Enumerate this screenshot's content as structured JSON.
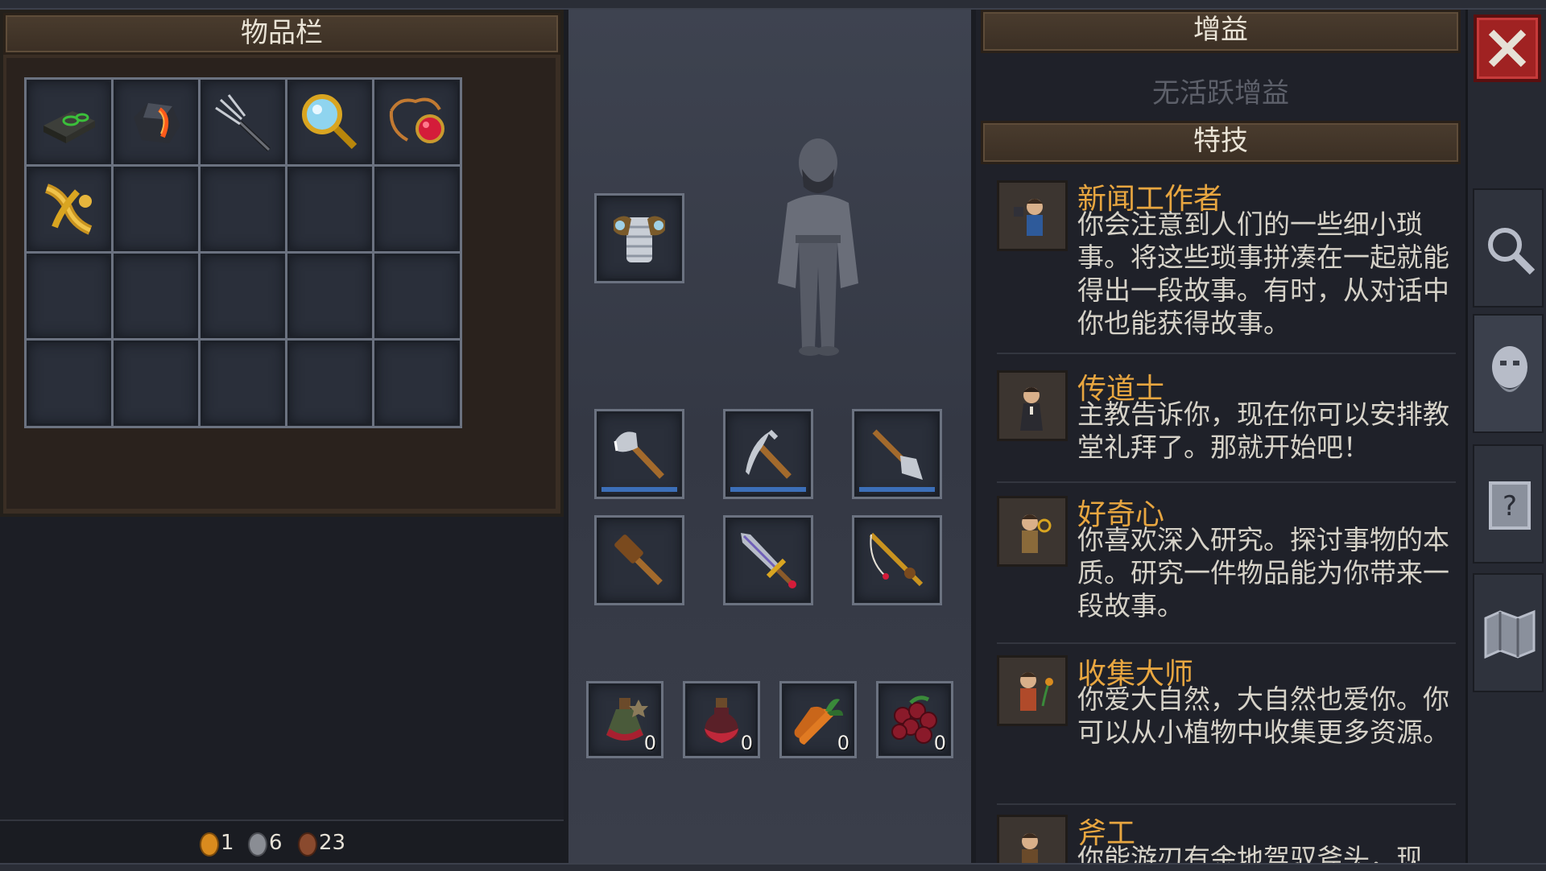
{
  "inventory": {
    "title": "物品栏",
    "items": [
      {
        "icon": "book-icon"
      },
      {
        "icon": "coal-ore-icon"
      },
      {
        "icon": "pitchfork-icon"
      },
      {
        "icon": "magnifying-glass-icon"
      },
      {
        "icon": "ruby-amulet-icon"
      },
      {
        "icon": "golden-horn-icon"
      },
      {
        "icon": ""
      },
      {
        "icon": ""
      },
      {
        "icon": ""
      },
      {
        "icon": ""
      },
      {
        "icon": ""
      },
      {
        "icon": ""
      },
      {
        "icon": ""
      },
      {
        "icon": ""
      },
      {
        "icon": ""
      },
      {
        "icon": ""
      },
      {
        "icon": ""
      },
      {
        "icon": ""
      },
      {
        "icon": ""
      },
      {
        "icon": ""
      }
    ],
    "coins": {
      "gold": "1",
      "silver": "6",
      "copper": "23"
    }
  },
  "equipment": {
    "armor_icon": "chest-armor-icon",
    "tools": [
      "axe-icon",
      "pickaxe-icon",
      "shovel-icon",
      "hammer-icon",
      "sword-icon",
      "fishing-rod-icon"
    ],
    "consumables": [
      {
        "icon": "herbal-potion-icon",
        "count": "0"
      },
      {
        "icon": "red-potion-icon",
        "count": "0"
      },
      {
        "icon": "carrot-icon",
        "count": "0"
      },
      {
        "icon": "berries-icon",
        "count": "0"
      }
    ]
  },
  "buffs": {
    "title": "增益",
    "empty_text": "无活跃增益"
  },
  "perks": {
    "title": "特技",
    "items": [
      {
        "title": "新闻工作者",
        "desc": "你会注意到人们的一些细小琐事。将这些琐事拼凑在一起就能得出一段故事。有时，从对话中你也能获得故事。"
      },
      {
        "title": "传道士",
        "desc": "主教告诉你，现在你可以安排教堂礼拜了。那就开始吧！"
      },
      {
        "title": "好奇心",
        "desc": "你喜欢深入研究。探讨事物的本质。研究一件物品能为你带来一段故事。"
      },
      {
        "title": "收集大师",
        "desc": "你爱大自然，大自然也爱你。你可以从小植物中收集更多资源。"
      },
      {
        "title": "斧工",
        "desc": "你能游刃有余地驾驭斧头，现"
      }
    ]
  },
  "sidebar": [
    "search-icon",
    "character-portrait-icon",
    "quest-scroll-icon",
    "map-icon"
  ],
  "colors": {
    "accent": "#e8a640",
    "close": "#a02222",
    "tool_durability": "#3c6fb8"
  }
}
